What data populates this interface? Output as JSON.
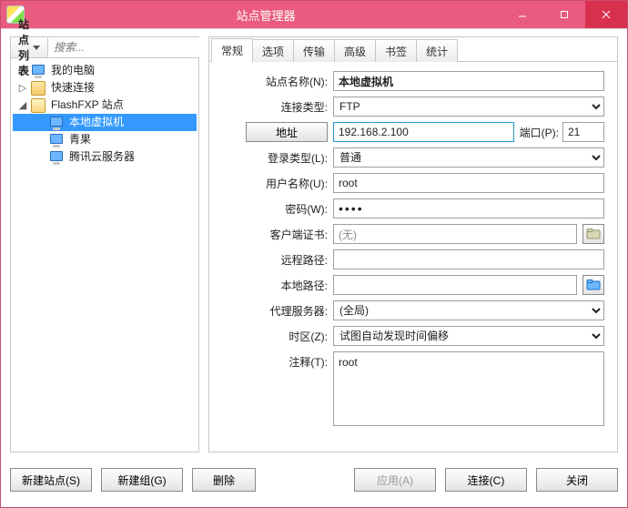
{
  "window": {
    "title": "站点管理器"
  },
  "left": {
    "heading": "站点列表",
    "search_placeholder": "搜索...",
    "tree": [
      "我的电脑",
      "快速连接",
      "FlashFXP 站点",
      "本地虚拟机",
      "青果",
      "腾讯云服务器"
    ]
  },
  "tabs": [
    "常规",
    "选项",
    "传输",
    "高级",
    "书签",
    "统计"
  ],
  "form": {
    "site_name": {
      "label": "站点名称(N):",
      "value": "本地虚拟机"
    },
    "conn_type": {
      "label": "连接类型:",
      "value": "FTP"
    },
    "address": {
      "button": "地址",
      "value": "192.168.2.100"
    },
    "port": {
      "label": "端口(P):",
      "value": "21"
    },
    "login_type": {
      "label": "登录类型(L):",
      "value": "普通"
    },
    "username": {
      "label": "用户名称(U):",
      "value": "root"
    },
    "password": {
      "label": "密码(W):",
      "value": "0000"
    },
    "client_cert": {
      "label": "客户端证书:",
      "value": "(无)"
    },
    "remote_path": {
      "label": "远程路径:",
      "value": ""
    },
    "local_path": {
      "label": "本地路径:",
      "value": ""
    },
    "proxy": {
      "label": "代理服务器:",
      "value": "(全局)"
    },
    "timezone": {
      "label": "时区(Z):",
      "value": "试图自动发现时间偏移"
    },
    "notes": {
      "label": "注释(T):",
      "value": "root"
    }
  },
  "footer": {
    "new_site": "新建站点(S)",
    "new_group": "新建组(G)",
    "delete": "删除",
    "apply": "应用(A)",
    "connect": "连接(C)",
    "close": "关闭"
  }
}
